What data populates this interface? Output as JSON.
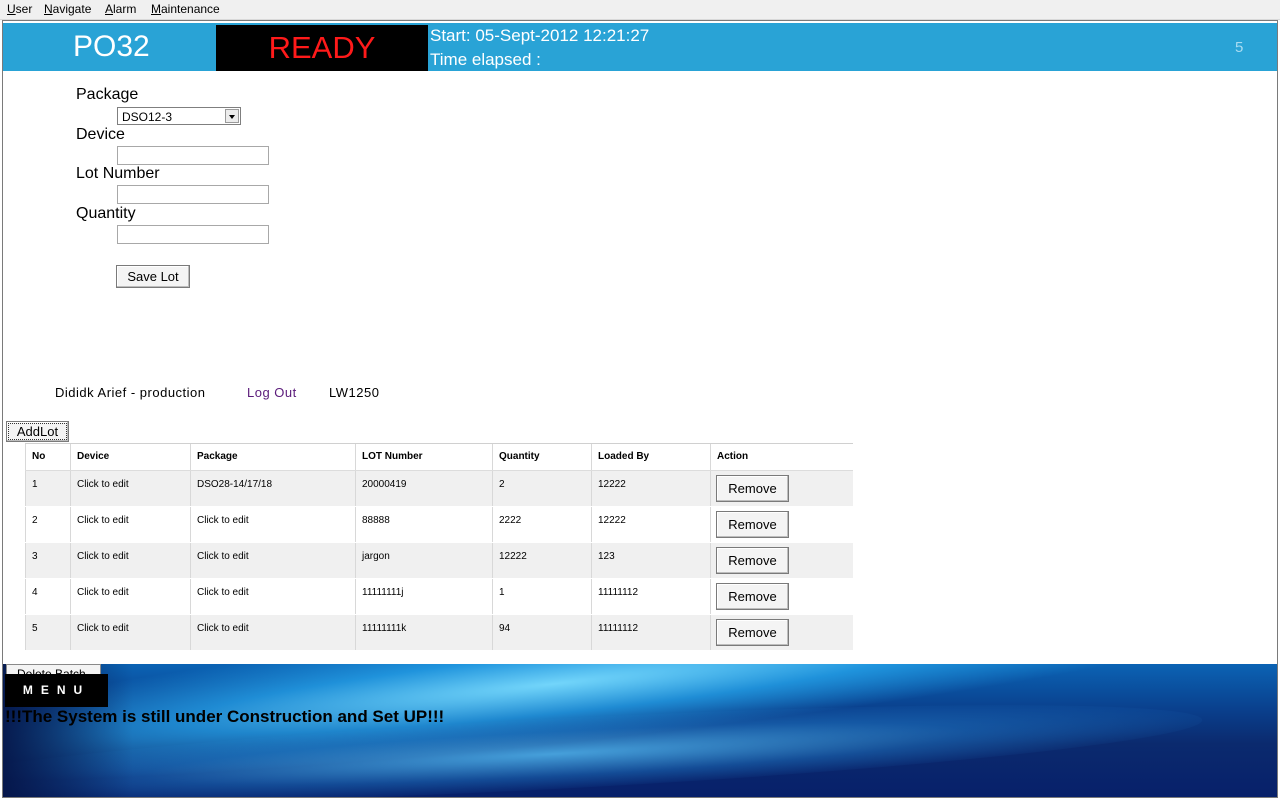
{
  "menubar": {
    "items": [
      "User",
      "Navigate",
      "Alarm",
      "Maintenance"
    ]
  },
  "header": {
    "station": "PO32",
    "status": "READY",
    "start": "Start: 05-Sept-2012 12:21:27",
    "elapsed": "Time elapsed :",
    "counter": "5"
  },
  "form": {
    "package_label": "Package",
    "package_value": "DSO12-3",
    "device_label": "Device",
    "device_value": "",
    "lot_label": "Lot Number",
    "lot_value": "",
    "qty_label": "Quantity",
    "qty_value": "",
    "save_label": "Save Lot"
  },
  "user": {
    "name": "Dididk Arief - production",
    "logout": "Log Out",
    "machine": "LW1250"
  },
  "table": {
    "add_label": "AddLot",
    "headers": [
      "No",
      "Device",
      "Package",
      "LOT Number",
      "Quantity",
      "Loaded By",
      "Action"
    ],
    "rows": [
      [
        "1",
        "Click to edit",
        "DSO28-14/17/18",
        "20000419",
        "2",
        "12222",
        "Remove"
      ],
      [
        "2",
        "Click to edit",
        "Click to edit",
        "88888",
        "2222",
        "12222",
        "Remove"
      ],
      [
        "3",
        "Click to edit",
        "Click to edit",
        "jargon",
        "12222",
        "123",
        "Remove"
      ],
      [
        "4",
        "Click to edit",
        "Click to edit",
        "11111111j",
        "1",
        "11111112",
        "Remove"
      ],
      [
        "5",
        "Click to edit",
        "Click to edit",
        "11111111k",
        "94",
        "11111112",
        "Remove"
      ]
    ]
  },
  "footer": {
    "delete_label": "Delete Batch",
    "menu_label": "MENU",
    "notice": "!!!The System is still under Construction and Set UP!!!"
  },
  "colors": {
    "header_bg": "#29a3d6",
    "status_text": "#ff1a1a",
    "logout_link": "#5a1a7a"
  }
}
